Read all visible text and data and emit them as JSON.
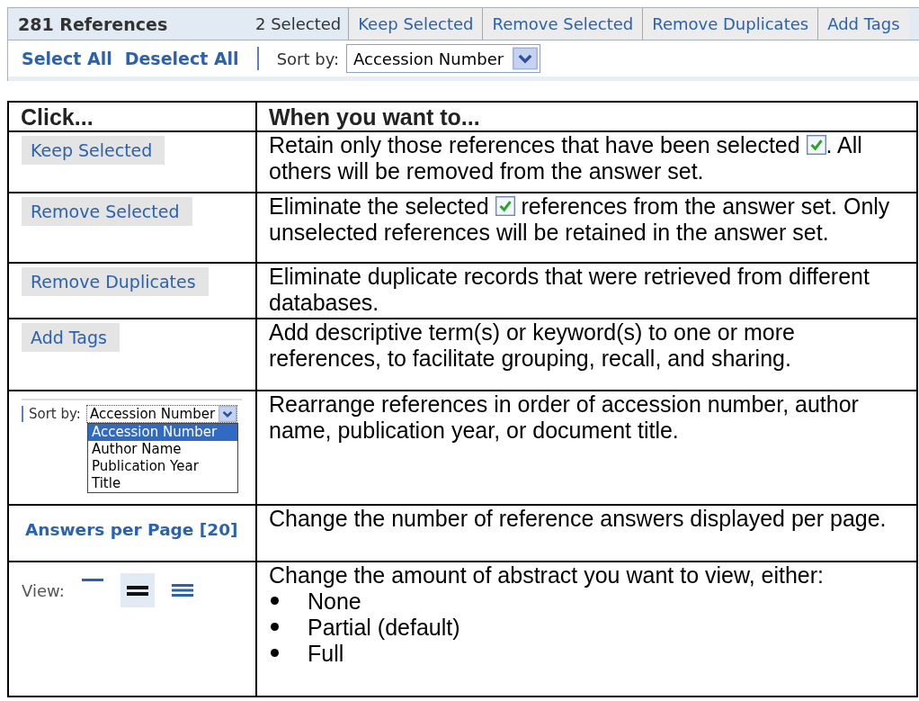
{
  "toolbar": {
    "count": "281 References",
    "selected_count": "2 Selected",
    "actions": [
      "Keep Selected",
      "Remove Selected",
      "Remove Duplicates",
      "Add Tags"
    ],
    "links": [
      "Select All",
      "Deselect All"
    ],
    "sort_label": "Sort by:",
    "sort_value": "Accession Number"
  },
  "table": {
    "columns": [
      "Click...",
      "When you want to..."
    ],
    "rows": [
      {
        "kind": "button",
        "label": "Keep Selected",
        "description": {
          "before": "Retain only those references that have been selected ",
          "checkbox": true,
          "after": ". All others will be removed from the answer set."
        }
      },
      {
        "kind": "button",
        "label": "Remove Selected",
        "description": {
          "before": "Eliminate the selected ",
          "checkbox": true,
          "after": " references from the answer set. Only unselected references will be retained in the answer set."
        }
      },
      {
        "kind": "button",
        "label": "Remove Duplicates",
        "description": {
          "before": "Eliminate duplicate records that were retrieved from different databases."
        }
      },
      {
        "kind": "button",
        "label": "Add Tags",
        "description": {
          "before": "Add descriptive term(s) or keyword(s) to one or more references, to facilitate grouping, recall, and sharing."
        }
      },
      {
        "kind": "sort-dropdown",
        "label": "Sort by:",
        "value": "Accession Number",
        "options": [
          {
            "label": "Accession Number",
            "selected": true
          },
          {
            "label": "Author Name",
            "selected": false
          },
          {
            "label": "Publication Year",
            "selected": false
          },
          {
            "label": "Title",
            "selected": false
          }
        ],
        "description": {
          "before": "Rearrange references in order of accession number, author name, publication year, or document title."
        }
      },
      {
        "kind": "link",
        "label": "Answers per Page [20]",
        "description": {
          "before": "Change the number of reference answers displayed per page."
        }
      },
      {
        "kind": "view-icons",
        "label": "View:",
        "options": [
          {
            "kind": "one-line",
            "selected": false
          },
          {
            "kind": "two-line",
            "selected": true
          },
          {
            "kind": "three-line",
            "selected": false
          }
        ],
        "description": {
          "before": "Change the amount of abstract you want to view, either:",
          "bullets": [
            "None",
            "Partial (default)",
            "Full"
          ]
        }
      }
    ]
  }
}
